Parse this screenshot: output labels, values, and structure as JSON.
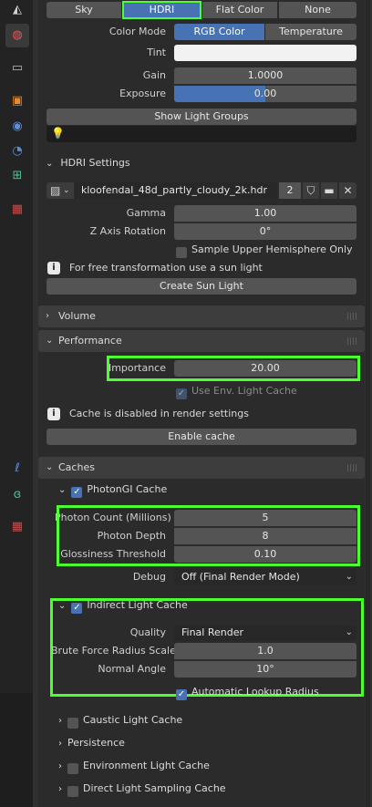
{
  "world_tabs": [
    "Sky",
    "HDRI",
    "Flat Color",
    "None"
  ],
  "color_mode": {
    "label": "Color Mode",
    "options": [
      "RGB Color",
      "Temperature"
    ],
    "selected": "RGB Color"
  },
  "tint": {
    "label": "Tint"
  },
  "gain": {
    "label": "Gain",
    "value": "1.0000"
  },
  "exposure": {
    "label": "Exposure",
    "value": "0.00"
  },
  "show_light_groups": "Show Light Groups",
  "hdri_settings": {
    "title": "HDRI Settings",
    "image_name": "kloofendal_48d_partly_cloudy_2k.hdr",
    "users": "2"
  },
  "gamma": {
    "label": "Gamma",
    "value": "1.00"
  },
  "z_axis_rotation": {
    "label": "Z Axis Rotation",
    "value": "0°"
  },
  "sample_upper": "Sample Upper Hemisphere Only",
  "sun_info": "For free transformation use a sun light",
  "create_sun": "Create Sun Light",
  "volume": "Volume",
  "performance": "Performance",
  "importance": {
    "label": "Importance",
    "value": "20.00"
  },
  "use_env_cache": "Use Env. Light Cache",
  "cache_info": "Cache is disabled in render settings",
  "enable_cache": "Enable cache",
  "caches": "Caches",
  "photongi": "PhotonGI Cache",
  "photon_count": {
    "label": "Photon Count (Millions)",
    "value": "5"
  },
  "photon_depth": {
    "label": "Photon Depth",
    "value": "8"
  },
  "glossiness": {
    "label": "Glossiness Threshold",
    "value": "0.10"
  },
  "debug": {
    "label": "Debug",
    "value": "Off (Final Render Mode)"
  },
  "indirect": "Indirect Light Cache",
  "quality": {
    "label": "Quality",
    "value": "Final Render"
  },
  "brute_force": {
    "label": "Brute Force Radius Scale",
    "value": "1.0"
  },
  "normal_angle": {
    "label": "Normal Angle",
    "value": "10°"
  },
  "auto_lookup": "Automatic Lookup Radius",
  "caustic": "Caustic Light Cache",
  "persistence": "Persistence",
  "env_cache": "Environment Light Cache",
  "direct_sampling": "Direct Light Sampling Cache",
  "colors": {
    "accent": "#4772b3",
    "highlight": "#4cff2e",
    "panel": "#2b2b2b",
    "field": "#545454"
  }
}
